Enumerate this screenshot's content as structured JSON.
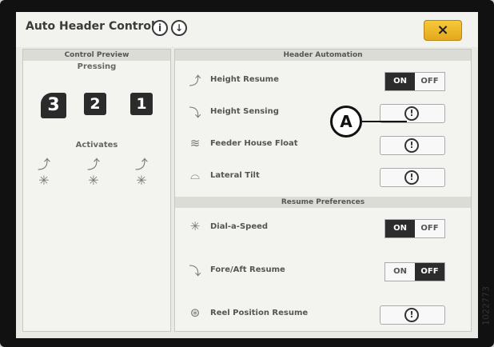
{
  "title": "Auto Header Controls",
  "header_icons": [
    "info-icon",
    "download-icon"
  ],
  "close_label": "×",
  "control_preview": {
    "heading": "Control Preview",
    "pressing_label": "Pressing",
    "buttons": [
      "3",
      "2",
      "1"
    ],
    "activates_label": "Activates"
  },
  "header_automation": {
    "heading": "Header Automation",
    "rows": [
      {
        "label": "Height Resume",
        "control": "toggle",
        "on": "ON",
        "off": "OFF",
        "active": "ON"
      },
      {
        "label": "Height Sensing",
        "control": "warning"
      },
      {
        "label": "Feeder House Float",
        "control": "warning"
      },
      {
        "label": "Lateral Tilt",
        "control": "warning"
      }
    ]
  },
  "resume_preferences": {
    "heading": "Resume Preferences",
    "rows": [
      {
        "label": "Dial-a-Speed",
        "control": "toggle",
        "on": "ON",
        "off": "OFF",
        "active": "ON"
      },
      {
        "label": "Fore/Aft Resume",
        "control": "toggle",
        "on": "ON",
        "off": "OFF",
        "active": "OFF"
      },
      {
        "label": "Reel Position Resume",
        "control": "warning"
      }
    ]
  },
  "warning_glyph": "!",
  "callout": "A",
  "figure_number": "1022773"
}
